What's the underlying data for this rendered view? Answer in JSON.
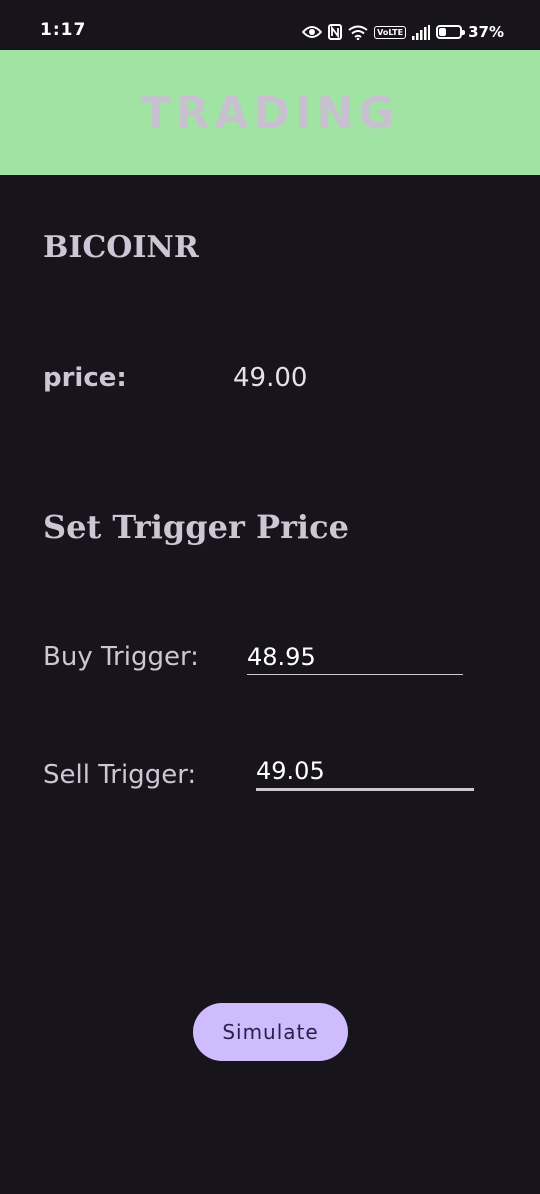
{
  "status_bar": {
    "time": "1:17",
    "battery_percent": "37%",
    "battery_level": 0.37,
    "volte_label": "VoLTE",
    "icons": [
      "eye-icon",
      "nfc-icon",
      "wifi-icon",
      "volte-icon",
      "signal-icon",
      "battery-icon"
    ]
  },
  "app_bar": {
    "title": "TRADING",
    "background_color": "#a0e3a3"
  },
  "main": {
    "pair_name": "BICOINR",
    "price_label": "price:",
    "price_value": "49.00",
    "section_title": "Set Trigger Price",
    "buy_trigger": {
      "label": "Buy Trigger:",
      "value": "48.95"
    },
    "sell_trigger": {
      "label": "Sell Trigger:",
      "value": "49.05"
    },
    "simulate_button": {
      "label": "Simulate",
      "color": "#cfbcff"
    }
  }
}
